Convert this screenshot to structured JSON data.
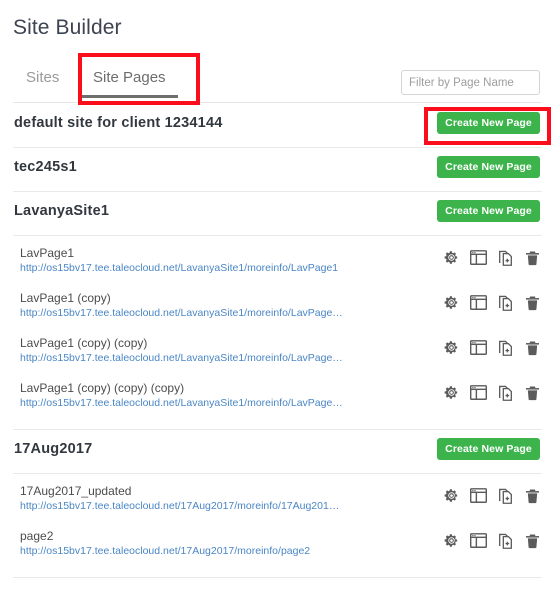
{
  "header": {
    "app_title": "Site Builder"
  },
  "tabs": [
    {
      "label": "Sites",
      "active": false,
      "name": "tab-sites"
    },
    {
      "label": "Site Pages",
      "active": true,
      "name": "tab-site-pages"
    }
  ],
  "filter": {
    "placeholder": "Filter by Page Name",
    "value": ""
  },
  "labels": {
    "create_new_page": "Create New Page"
  },
  "colors": {
    "accent_green": "#3cb44b",
    "link_blue": "#4a86c5",
    "annotation_red": "#fc0d1b",
    "title_dark": "#3c4452"
  },
  "row_action_icons": [
    {
      "name": "gear-icon",
      "title": "Settings"
    },
    {
      "name": "browser-window-icon",
      "title": "Preview"
    },
    {
      "name": "copy-page-icon",
      "title": "Duplicate"
    },
    {
      "name": "trash-icon",
      "title": "Delete"
    }
  ],
  "sites": [
    {
      "name": "default site for client 1234144",
      "create_label": "Create New Page",
      "pages": []
    },
    {
      "name": "tec245s1",
      "create_label": "Create New Page",
      "pages": []
    },
    {
      "name": "LavanyaSite1",
      "create_label": "Create New Page",
      "pages": [
        {
          "title": "LavPage1",
          "url": "http://os15bv17.tee.taleocloud.net/LavanyaSite1/moreinfo/LavPage1"
        },
        {
          "title": "LavPage1 (copy)",
          "url": "http://os15bv17.tee.taleocloud.net/LavanyaSite1/moreinfo/LavPage…"
        },
        {
          "title": "LavPage1 (copy) (copy)",
          "url": "http://os15bv17.tee.taleocloud.net/LavanyaSite1/moreinfo/LavPage…"
        },
        {
          "title": "LavPage1 (copy) (copy) (copy)",
          "url": "http://os15bv17.tee.taleocloud.net/LavanyaSite1/moreinfo/LavPage…"
        }
      ]
    },
    {
      "name": "17Aug2017",
      "create_label": "Create New Page",
      "pages": [
        {
          "title": "17Aug2017_updated",
          "url": "http://os15bv17.tee.taleocloud.net/17Aug2017/moreinfo/17Aug201…"
        },
        {
          "title": "page2",
          "url": "http://os15bv17.tee.taleocloud.net/17Aug2017/moreinfo/page2"
        }
      ]
    }
  ],
  "annotations": [
    {
      "name": "annotation-site-pages-tab",
      "target": "tab-site-pages"
    },
    {
      "name": "annotation-create-new-page",
      "target": "create-new-page-button-0"
    }
  ]
}
